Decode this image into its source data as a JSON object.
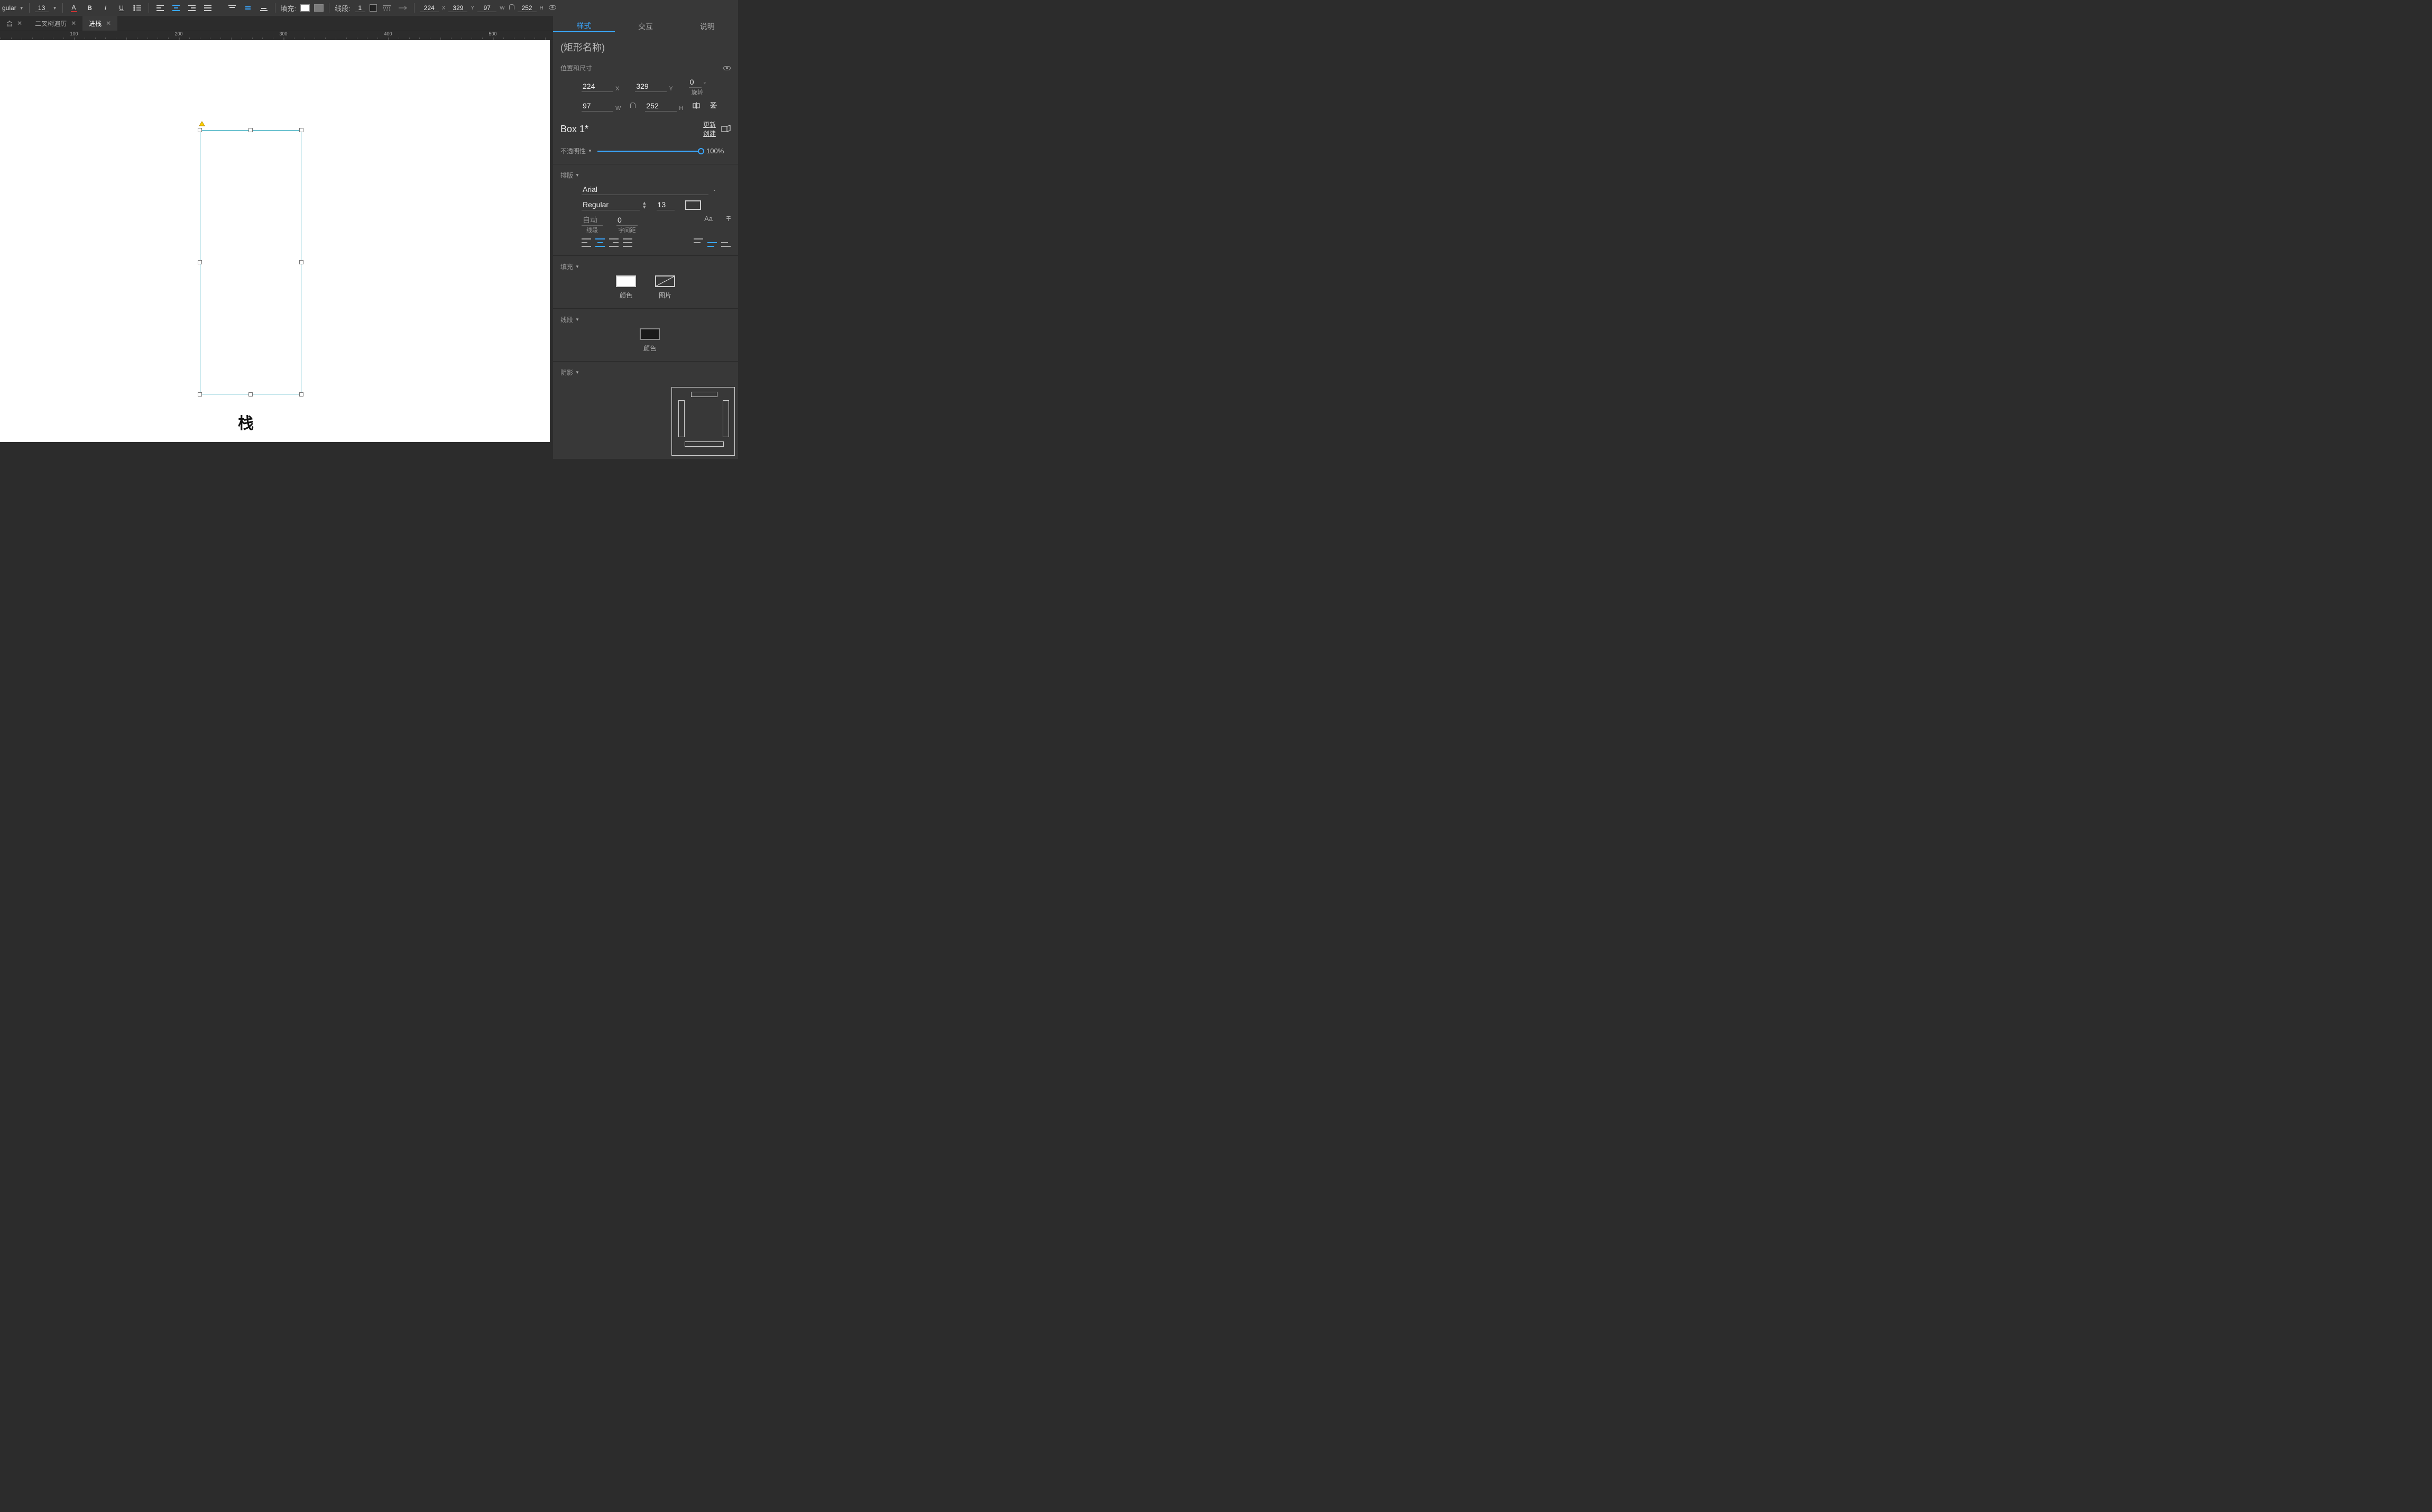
{
  "toolbar": {
    "font_weight": "gular",
    "font_size": "13",
    "fill_label": "填充:",
    "line_label": "线段:",
    "line_width": "1",
    "x": "224",
    "y": "329",
    "w": "97",
    "h": "252"
  },
  "tabs": [
    {
      "label": "合",
      "active": false
    },
    {
      "label": "二叉树遍历",
      "active": false
    },
    {
      "label": "进栈",
      "active": true
    }
  ],
  "ruler": {
    "labels": [
      "100",
      "200",
      "300",
      "400",
      "500"
    ]
  },
  "canvas": {
    "stack_label": "栈"
  },
  "panel": {
    "tabs": {
      "style": "样式",
      "interaction": "交互",
      "notes": "说明"
    },
    "shape_name": "(矩形名称)",
    "pos_size": {
      "title": "位置和尺寸",
      "x": "224",
      "y": "329",
      "rot": "0",
      "rot_label": "旋转",
      "w": "97",
      "h": "252"
    },
    "component": {
      "name": "Box 1*",
      "update": "更新",
      "create": "创建"
    },
    "opacity": {
      "label": "不透明性",
      "value": "100%"
    },
    "typography": {
      "title": "排版",
      "font": "Arial",
      "weight": "Regular",
      "size": "13",
      "auto": "自动",
      "letter_spacing": "0",
      "line_label": "线段",
      "ls_label": "字间距"
    },
    "fill": {
      "title": "填充",
      "color_label": "颜色",
      "image_label": "图片"
    },
    "line": {
      "title": "线段",
      "color_label": "颜色",
      "width": "1"
    },
    "shadow": {
      "title": "阴影"
    }
  }
}
